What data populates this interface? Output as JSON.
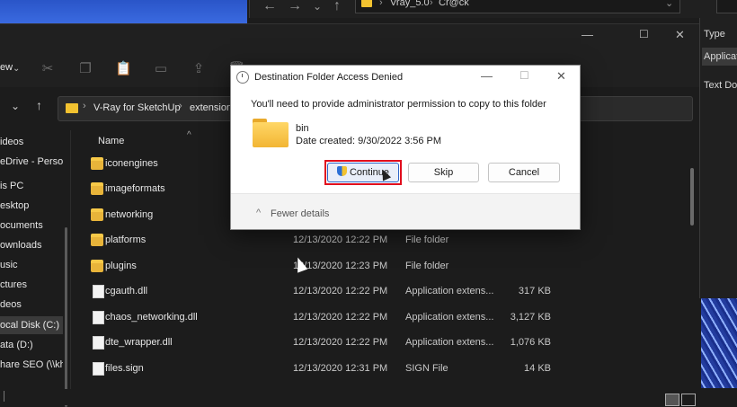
{
  "back_window": {
    "path": [
      "Vray_5.0",
      "Cr@ck"
    ],
    "right_columns": [
      "Type",
      "Applicat",
      "Text Do"
    ]
  },
  "explorer": {
    "toolbar_fragment": "ew",
    "breadcrumb": [
      "V-Ray for SketchUp",
      "extension"
    ],
    "sidebar": [
      {
        "label": "ideos"
      },
      {
        "label": "eDrive - Person"
      },
      {
        "label": "is PC"
      },
      {
        "label": "esktop"
      },
      {
        "label": "ocuments"
      },
      {
        "label": "ownloads"
      },
      {
        "label": "usic"
      },
      {
        "label": "ctures"
      },
      {
        "label": "deos"
      },
      {
        "label": "ocal Disk (C:)"
      },
      {
        "label": "ata (D:)"
      },
      {
        "label": "hare SEO (\\\\kha"
      }
    ],
    "columns": {
      "name": "Name"
    },
    "rows": [
      {
        "name": "iconengines",
        "date": "",
        "type": "",
        "size": "",
        "kind": "folder"
      },
      {
        "name": "imageformats",
        "date": "",
        "type": "",
        "size": "",
        "kind": "folder"
      },
      {
        "name": "networking",
        "date": "",
        "type": "",
        "size": "",
        "kind": "folder"
      },
      {
        "name": "platforms",
        "date": "12/13/2020 12:22 PM",
        "type": "File folder",
        "size": "",
        "kind": "folder"
      },
      {
        "name": "plugins",
        "date": "12/13/2020 12:23 PM",
        "type": "File folder",
        "size": "",
        "kind": "folder"
      },
      {
        "name": "cgauth.dll",
        "date": "12/13/2020 12:22 PM",
        "type": "Application extens...",
        "size": "317 KB",
        "kind": "file"
      },
      {
        "name": "chaos_networking.dll",
        "date": "12/13/2020 12:22 PM",
        "type": "Application extens...",
        "size": "3,127 KB",
        "kind": "file"
      },
      {
        "name": "dte_wrapper.dll",
        "date": "12/13/2020 12:22 PM",
        "type": "Application extens...",
        "size": "1,076 KB",
        "kind": "file"
      },
      {
        "name": "files.sign",
        "date": "12/13/2020 12:31 PM",
        "type": "SIGN File",
        "size": "14 KB",
        "kind": "file"
      }
    ]
  },
  "dialog": {
    "title": "Destination Folder Access Denied",
    "message": "You'll need to provide administrator permission to copy to this folder",
    "folder_name": "bin",
    "folder_date": "Date created: 9/30/2022 3:56 PM",
    "btn_continue": "Continue",
    "btn_skip": "Skip",
    "btn_cancel": "Cancel",
    "fewer_details": "Fewer details"
  },
  "colors": {
    "highlight": "#e10d1d",
    "folder": "#f2b534",
    "dark_bg": "#1c1c1c"
  }
}
